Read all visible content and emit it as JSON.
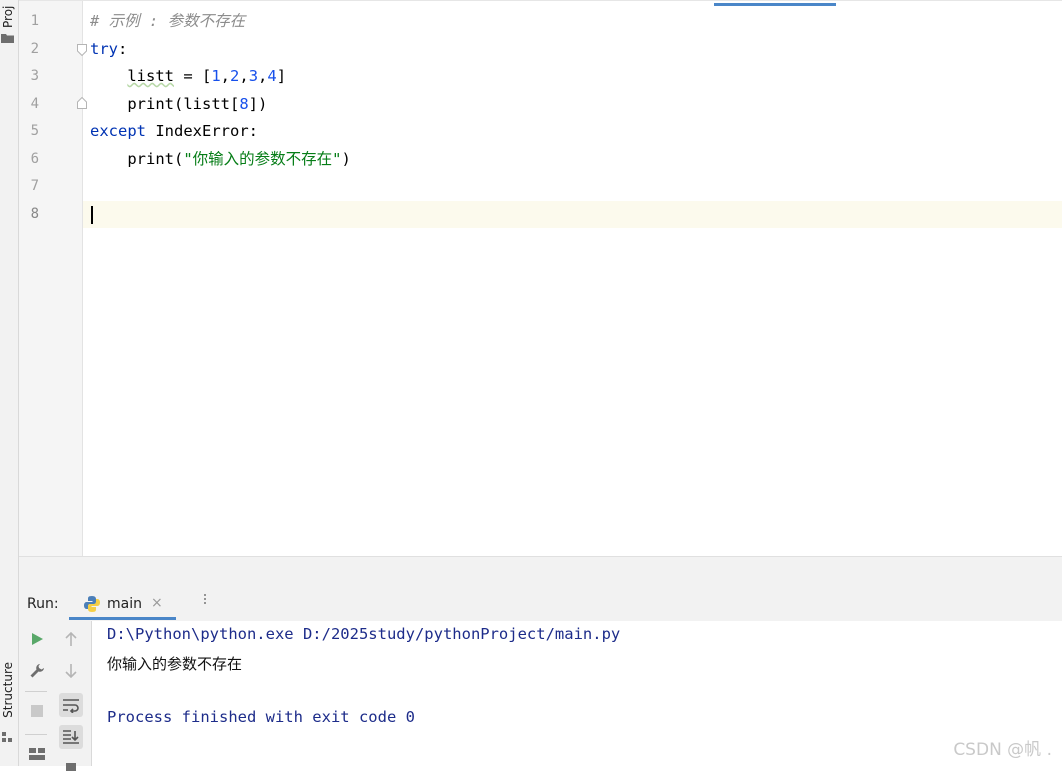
{
  "sidebar": {
    "project_label": "Proj",
    "structure_label": "Structure"
  },
  "editor": {
    "line_numbers": [
      "1",
      "2",
      "3",
      "4",
      "5",
      "6",
      "7",
      "8"
    ],
    "lines": {
      "l1": {
        "comment": "# 示例 : 参数不存在"
      },
      "l2": {
        "kw": "try",
        "colon": ":"
      },
      "l3": {
        "indent": "    ",
        "var": "listt",
        "op": " = [",
        "n1": "1",
        "c1": ",",
        "n2": "2",
        "c2": ",",
        "n3": "3",
        "c3": ",",
        "n4": "4",
        "close": "]"
      },
      "l4": {
        "indent": "    ",
        "pre": "print(listt[",
        "idx": "8",
        "post": "])"
      },
      "l5": {
        "kw": "except",
        "rest": " IndexError:"
      },
      "l6": {
        "indent": "    ",
        "pre": "print(",
        "str": "\"你输入的参数不存在\"",
        "post": ")"
      }
    }
  },
  "run_panel": {
    "label": "Run:",
    "tab_name": "main",
    "tab_close": "×",
    "console": [
      "D:\\Python\\python.exe D:/2025study/pythonProject/main.py",
      "你输入的参数不存在",
      "",
      "Process finished with exit code 0"
    ]
  },
  "watermark": "CSDN @帆 .",
  "colors": {
    "keyword": "#0033b3",
    "number": "#1750eb",
    "string": "#067d17",
    "comment": "#8c8c8c",
    "accent": "#4a86c8"
  }
}
